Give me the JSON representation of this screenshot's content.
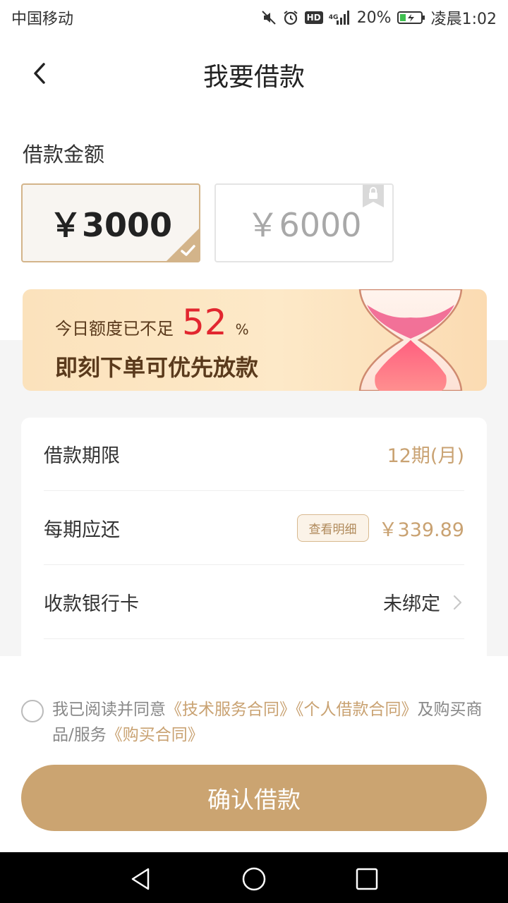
{
  "status_bar": {
    "carrier": "中国移动",
    "network": "4G",
    "battery": "20%",
    "time": "凌晨1:02",
    "icons": [
      "mute-icon",
      "alarm-icon",
      "hd-icon",
      "signal-icon",
      "battery-icon"
    ]
  },
  "header": {
    "title": "我要借款",
    "back_icon": "back-icon"
  },
  "amount_section": {
    "label": "借款金额",
    "options": [
      {
        "label": "￥3000",
        "selected": true,
        "locked": false
      },
      {
        "label": "￥6000",
        "selected": false,
        "locked": true
      }
    ]
  },
  "banner": {
    "prefix": "今日额度已不足",
    "percent": "52",
    "unit": "%",
    "headline": "即刻下单可优先放款",
    "icon": "hourglass-icon"
  },
  "details": {
    "term": {
      "label": "借款期限",
      "value": "12期(月)"
    },
    "installment": {
      "label": "每期应还",
      "chip": "查看明细",
      "value": "￥339.89"
    },
    "bank_card": {
      "label": "收款银行卡",
      "value": "未绑定"
    }
  },
  "agreement": {
    "prefix": "我已阅读并同意",
    "link1": "《技术服务合同》",
    "link2": "《个人借款合同》",
    "middle": "及购买商品/服务",
    "link3": "《购买合同》"
  },
  "confirm_button": "确认借款",
  "colors": {
    "accent": "#cba471",
    "accent_text": "#c9a272",
    "highlight_red": "#e2262f",
    "banner_text": "#5a3a1c"
  }
}
